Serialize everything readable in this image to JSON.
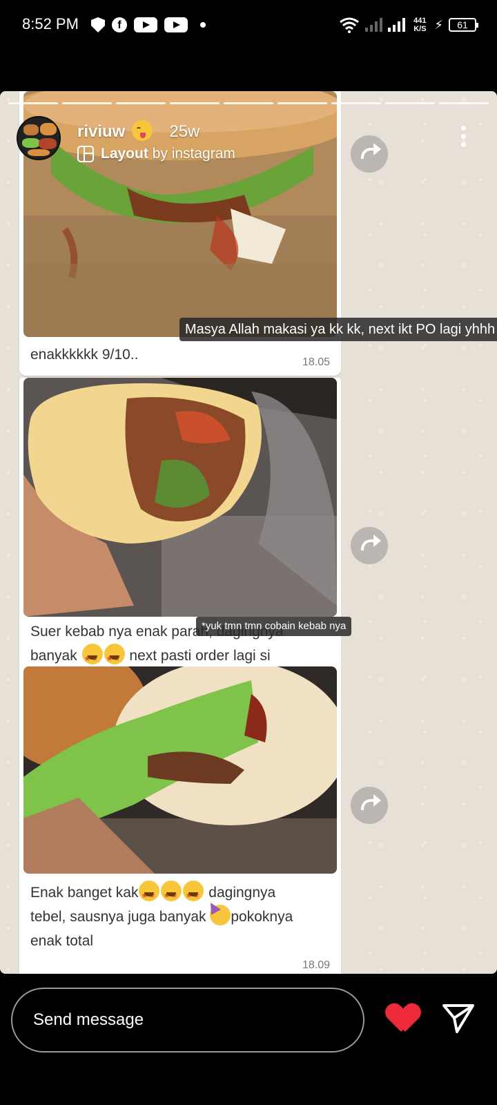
{
  "status_bar": {
    "time": "8:52 PM",
    "network_speed_value": "441",
    "network_speed_unit": "K/S",
    "battery": "61"
  },
  "story": {
    "segment_count": 9,
    "username": "riviuw",
    "time_ago": "25w",
    "layout_label": "Layout",
    "layout_suffix": "by instagram",
    "icons": [
      "shield-icon",
      "facebook-icon",
      "youtube-icon",
      "wifi-icon",
      "signal-icon",
      "charging-icon",
      "battery-icon",
      "layout-icon",
      "more-icon",
      "forward-icon",
      "heart-icon",
      "share-icon"
    ],
    "messages": [
      {
        "overlay": "Masya Allah makasi ya kk kk, next ikt PO lagi yhhh",
        "caption": "enakkkkkk 9/10..",
        "time": "18.05"
      },
      {
        "overlay": "*yuk tmn tmn cobain kebab nya",
        "caption_line1": "Suer kebab nya enak parah, dagingnya",
        "caption_line2_a": "banyak",
        "caption_line2_b": "next pasti order lagi si"
      },
      {
        "caption_line1_a": "Enak banget kak",
        "caption_line1_b": "dagingnya",
        "caption_line2_a": "tebel, sausnya juga banyak",
        "caption_line2_b": "pokoknya",
        "caption_line3": "enak total",
        "time": "18.09"
      }
    ]
  },
  "bottom_bar": {
    "message_placeholder": "Send message"
  },
  "colors": {
    "background": "#000000",
    "heart": "#ed2a3b",
    "chat_bg": "#e6e0d6",
    "bubble": "#ffffff"
  }
}
